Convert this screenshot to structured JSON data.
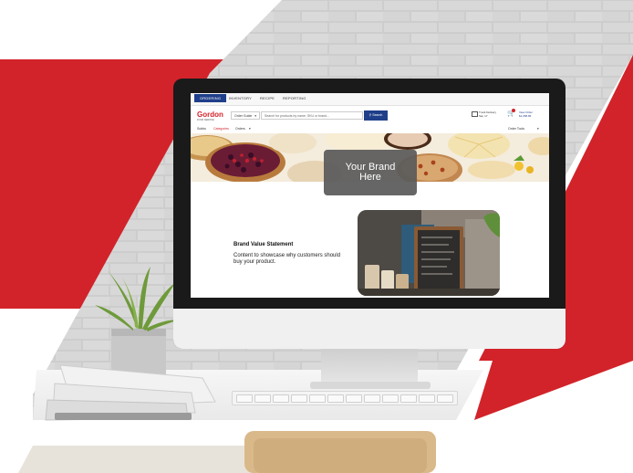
{
  "colors": {
    "brand_red": "#d2232a",
    "nav_blue": "#1f3f8a"
  },
  "screen": {
    "nav_tabs": [
      "ORDERING",
      "INVENTORY",
      "RECIPE",
      "REPORTING"
    ],
    "logo": {
      "name": "Gordon",
      "subtitle": "FOOD SERVICE"
    },
    "order_guide_label": "Order Guide",
    "search_placeholder": "Search for products by name, SKU or brand...",
    "search_button_label": "Search",
    "delivery": {
      "line1": "Truck Delivery",
      "line2": "Sat, 17"
    },
    "cart": {
      "line1": "View Order",
      "line2": "$1,058.86"
    },
    "subnav": {
      "items": [
        "Subbs",
        "Categories",
        "Orders"
      ],
      "right": "Order Tools"
    },
    "brand_box": {
      "line1": "Your Brand",
      "line2": "Here"
    },
    "brand_value": {
      "title": "Brand Value Statement",
      "body": "Content to showcase why customers should buy your product."
    },
    "chalkboard_lines": [
      "Cappuccino 3.20",
      "Latte 3.40",
      "Cortado 3.00",
      "Americano 2.80",
      "Macchiato 3.00",
      "Espresso 2.60"
    ]
  }
}
